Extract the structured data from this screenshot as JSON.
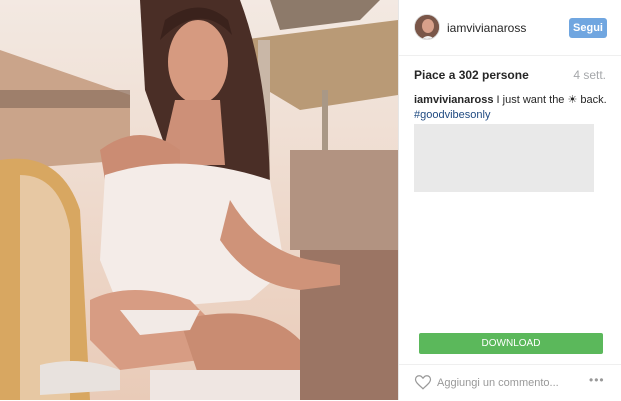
{
  "post": {
    "username": "iamvivianaross",
    "follow_label": "Segui",
    "likes_text": "Piace a 302 persone",
    "age": "4 sett.",
    "caption_user": "iamvivianaross",
    "caption_text": " I just want the ☀ back.",
    "hashtag": "#goodvibesonly"
  },
  "actions": {
    "download_label": "DOWNLOAD",
    "comment_placeholder": "Aggiungi un commento...",
    "more_label": "•••"
  },
  "icons": {
    "like": "heart-icon",
    "more": "more-options-icon"
  },
  "colors": {
    "follow_button": "#70a6e0",
    "download_button": "#5bb85b",
    "hashtag": "#1f4a81"
  }
}
